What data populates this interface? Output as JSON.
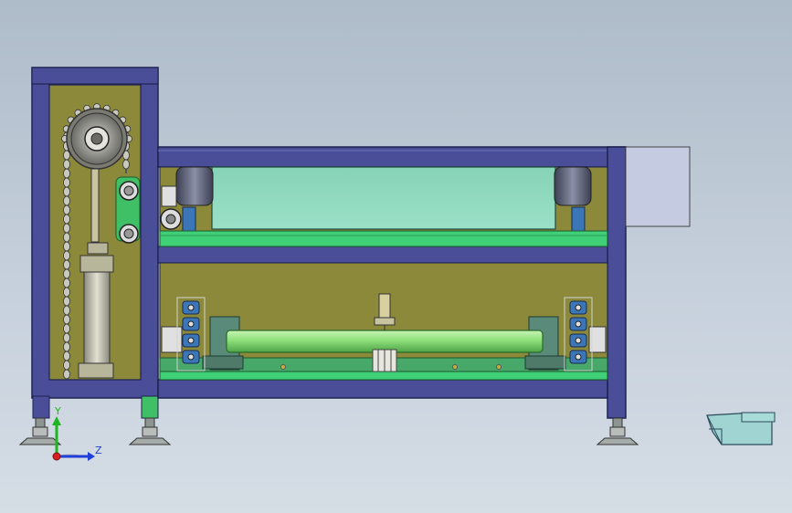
{
  "view": {
    "background_top": "#aebbc9",
    "background_bottom": "#d5dde5"
  },
  "colors": {
    "frame": "#4a4e98",
    "frame_dark": "#1e2250",
    "panel": "#8c8a3a",
    "roller": "#8fd6bd",
    "green": "#3fcf77",
    "shaft": "#8ee07a",
    "sprocket": "#3b76b8",
    "motor_box": "#c5cbe0",
    "base": "#9aa5a0",
    "pedal": "#9fd4d2"
  },
  "triad": {
    "y_label": "Y",
    "z_label": "Z"
  },
  "parts": {
    "left_column": "left-column-frame",
    "chain_drive": "chain-drive",
    "upper_roller": "upper-roller",
    "lower_shaft": "lower-shaft",
    "side_box": "motor-box",
    "foot_pedal": "foot-pedal"
  }
}
